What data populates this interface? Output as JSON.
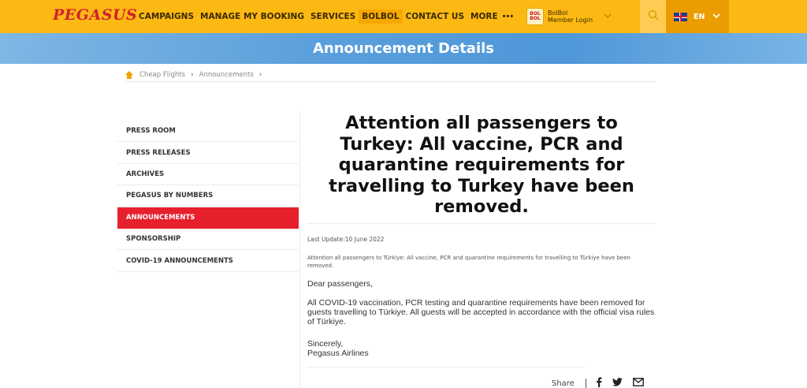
{
  "header": {
    "logo": "PEGASUS",
    "nav": [
      "CAMPAIGNS",
      "MANAGE MY BOOKING",
      "SERVICES",
      "BOLBOL",
      "CONTACT US",
      "MORE"
    ],
    "more_dots": "•••",
    "bolbol_badge": "BOL BOL",
    "bolbol_line1": "BolBol",
    "bolbol_line2": "Member Login",
    "language": "EN"
  },
  "banner": {
    "title": "Announcement Details"
  },
  "breadcrumb": [
    "Cheap Flights",
    "Announcements"
  ],
  "sidebar": {
    "items": [
      "PRESS ROOM",
      "PRESS RELEASES",
      "ARCHIVES",
      "PEGASUS BY NUMBERS",
      "ANNOUNCEMENTS",
      "SPONSORSHIP",
      "COVID-19 ANNOUNCEMENTS"
    ],
    "active": "ANNOUNCEMENTS"
  },
  "article": {
    "title": "Attention all passengers to Turkey: All vaccine, PCR and quarantine requirements for travelling to Turkey have been removed.",
    "last_update": "Last Update:10 June 2022",
    "summary": "Attention all passengers to Türkiye: All vaccine, PCR and quarantine requirements for travelling to Türkiye have been removed.",
    "greeting": "Dear passengers,",
    "body": "All COVID-19 vaccination, PCR testing and quarantine requirements have been removed for guests travelling to Türkiye. All guests will be accepted in accordance with the official visa rules of Türkiye.",
    "closing_line1": "Sincerely,",
    "closing_line2": "Pegasus Airlines"
  },
  "share": {
    "label": "Share",
    "icons": [
      "facebook-icon",
      "twitter-icon",
      "email-icon"
    ]
  },
  "colors": {
    "header": "#fdb913",
    "accent_red": "#e6202d",
    "banner": "#5a9fdc"
  }
}
